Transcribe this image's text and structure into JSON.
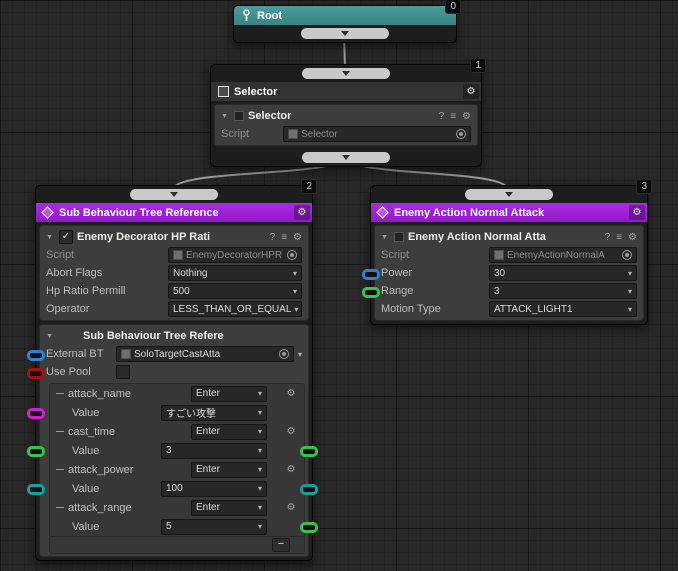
{
  "icons": {
    "gear": "⚙",
    "help": "?",
    "presets": "≡",
    "foldout": "▼",
    "dropdown": "▾",
    "check": "✓"
  },
  "colors": {
    "root_header": "#3a8585",
    "action_header": "#9318c9",
    "pill_blue": "#2f7fd6",
    "pill_red": "#a01313",
    "pill_magenta": "#cc22cc",
    "pill_green": "#35c24e",
    "pill_cyan": "#12a0a0"
  },
  "nodes": {
    "root": {
      "badge": "0",
      "title": "Root"
    },
    "selector": {
      "badge": "1",
      "title": "Selector",
      "inspector": {
        "header": "Selector",
        "script_label": "Script",
        "script_value": "Selector"
      }
    },
    "sub_tree": {
      "badge": "2",
      "title": "Sub Behaviour Tree Reference",
      "decorator": {
        "header": "Enemy Decorator HP Rati",
        "script_label": "Script",
        "script_value": "EnemyDecoratorHPR",
        "abort_label": "Abort Flags",
        "abort_value": "Nothing",
        "hp_label": "Hp Ratio Permill",
        "hp_value": "500",
        "operator_label": "Operator",
        "operator_value": "LESS_THAN_OR_EQUAL"
      },
      "reference": {
        "header": "Sub Behaviour Tree Refere",
        "external_bt_label": "External BT",
        "external_bt_value": "SoloTargetCastAtta",
        "use_pool_label": "Use Pool",
        "variables": [
          {
            "name": "attack_name",
            "mode": "Enter",
            "value_label": "Value",
            "value": "すごい攻撃"
          },
          {
            "name": "cast_time",
            "mode": "Enter",
            "value_label": "Value",
            "value": "3"
          },
          {
            "name": "attack_power",
            "mode": "Enter",
            "value_label": "Value",
            "value": "100"
          },
          {
            "name": "attack_range",
            "mode": "Enter",
            "value_label": "Value",
            "value": "5"
          }
        ],
        "remove_button": "−"
      }
    },
    "attack": {
      "badge": "3",
      "title": "Enemy Action Normal Attack",
      "inspector": {
        "header": "Enemy Action Normal Atta",
        "script_label": "Script",
        "script_value": "EnemyActionNormalA",
        "power_label": "Power",
        "power_value": "30",
        "range_label": "Range",
        "range_value": "3",
        "motion_label": "Motion Type",
        "motion_value": "ATTACK_LIGHT1"
      }
    }
  }
}
